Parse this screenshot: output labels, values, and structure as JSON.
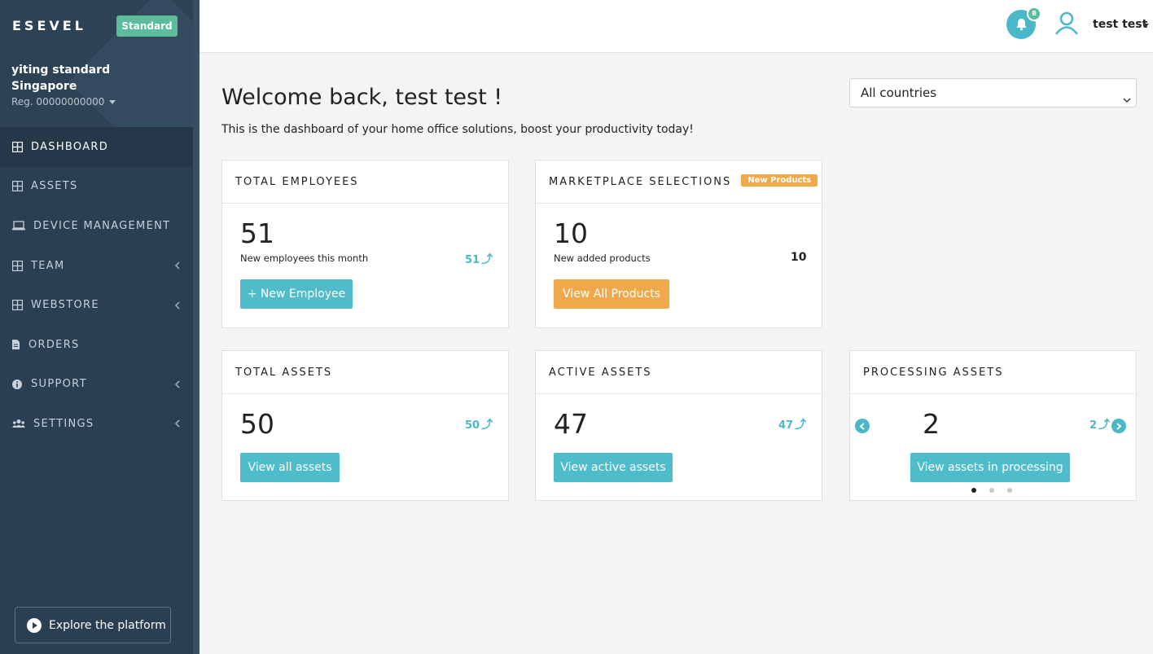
{
  "sidebar": {
    "logo": "ESEVEL",
    "plan_badge": "Standard",
    "company_name": "yiting standard Singapore",
    "reg": "Reg. 00000000000",
    "items": [
      {
        "label": "DASHBOARD",
        "icon": "grid-icon",
        "active": true,
        "has_chevron": false
      },
      {
        "label": "ASSETS",
        "icon": "grid-icon",
        "active": false,
        "has_chevron": false
      },
      {
        "label": "DEVICE MANAGEMENT",
        "icon": "laptop-icon",
        "active": false,
        "has_chevron": false
      },
      {
        "label": "TEAM",
        "icon": "grid-icon",
        "active": false,
        "has_chevron": true
      },
      {
        "label": "WEBSTORE",
        "icon": "grid-icon",
        "active": false,
        "has_chevron": true
      },
      {
        "label": "ORDERS",
        "icon": "document-icon",
        "active": false,
        "has_chevron": false
      },
      {
        "label": "SUPPORT",
        "icon": "info-icon",
        "active": false,
        "has_chevron": true
      },
      {
        "label": "SETTINGS",
        "icon": "users-icon",
        "active": false,
        "has_chevron": true
      }
    ],
    "explore_label": "Explore the platform"
  },
  "topbar": {
    "notification_count": "8",
    "user_name": "test test"
  },
  "main": {
    "welcome": "Welcome back, test test !",
    "subtitle": "This is the dashboard of your home office solutions, boost your productivity today!",
    "country_select": "All countries",
    "cards": {
      "employees": {
        "title": "TOTAL EMPLOYEES",
        "value": "51",
        "label": "New employees this month",
        "trend": "51",
        "button": "+ New Employee"
      },
      "marketplace": {
        "title": "MARKETPLACE SELECTIONS",
        "badge": "New Products",
        "value": "10",
        "label": "New added products",
        "count": "10",
        "button": "View All Products"
      },
      "total_assets": {
        "title": "TOTAL ASSETS",
        "value": "50",
        "trend": "50",
        "button": "View all assets"
      },
      "active_assets": {
        "title": "ACTIVE ASSETS",
        "value": "47",
        "trend": "47",
        "button": "View active assets"
      },
      "processing_assets": {
        "title": "PROCESSING ASSETS",
        "value": "2",
        "trend": "2",
        "button": "View assets in processing",
        "carousel_pages": 3,
        "carousel_active": 1
      }
    }
  },
  "colors": {
    "sidebar_bg": "#2b3f52",
    "accent_teal": "#4fbccb",
    "accent_orange": "#f0a94a",
    "badge_green": "#5bbd9a"
  }
}
